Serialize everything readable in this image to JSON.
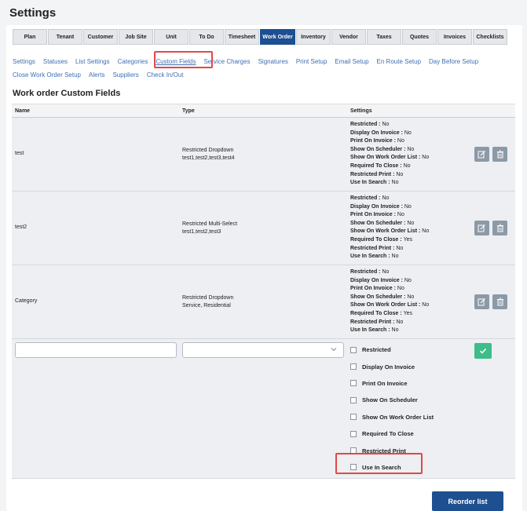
{
  "header": {
    "title": "Settings"
  },
  "main_tabs": [
    {
      "label": "Plan"
    },
    {
      "label": "Tenant"
    },
    {
      "label": "Customer"
    },
    {
      "label": "Job Site"
    },
    {
      "label": "Unit"
    },
    {
      "label": "To Do"
    },
    {
      "label": "Timesheet"
    },
    {
      "label": "Work Order"
    },
    {
      "label": "Inventory"
    },
    {
      "label": "Vendor"
    },
    {
      "label": "Taxes"
    },
    {
      "label": "Quotes"
    },
    {
      "label": "Invoices"
    },
    {
      "label": "Checklists"
    }
  ],
  "main_tabs_active": "Work Order",
  "subnav": {
    "row1": [
      {
        "label": "Settings"
      },
      {
        "label": "Statuses"
      },
      {
        "label": "List Settings"
      },
      {
        "label": "Categories"
      },
      {
        "label": "Custom Fields"
      },
      {
        "label": "Service Charges"
      },
      {
        "label": "Signatures"
      },
      {
        "label": "Print Setup"
      },
      {
        "label": "Email Setup"
      },
      {
        "label": "En Route Setup"
      },
      {
        "label": "Day Before Setup"
      }
    ],
    "row2": [
      {
        "label": "Close Work Order Setup"
      },
      {
        "label": "Alerts"
      },
      {
        "label": "Suppliers"
      },
      {
        "label": "Check In/Out"
      }
    ],
    "active": "Custom Fields"
  },
  "section": {
    "title": "Work order Custom Fields"
  },
  "table": {
    "headers": {
      "name": "Name",
      "type": "Type",
      "settings": "Settings"
    },
    "rows": [
      {
        "name": "test",
        "type_label": "Restricted Dropdown",
        "type_values": "test1,test2,test3,test4",
        "settings": [
          {
            "k": "Restricted",
            "v": "No"
          },
          {
            "k": "Display On Invoice",
            "v": "No"
          },
          {
            "k": "Print On Invoice",
            "v": "No"
          },
          {
            "k": "Show On Scheduler",
            "v": "No"
          },
          {
            "k": "Show On Work Order List",
            "v": "No"
          },
          {
            "k": "Required To Close",
            "v": "No"
          },
          {
            "k": "Restricted Print",
            "v": "No"
          },
          {
            "k": "Use In Search",
            "v": "No"
          }
        ]
      },
      {
        "name": "test2",
        "type_label": "Restricted Multi-Select",
        "type_values": "test1,test2,test3",
        "settings": [
          {
            "k": "Restricted",
            "v": "No"
          },
          {
            "k": "Display On Invoice",
            "v": "No"
          },
          {
            "k": "Print On Invoice",
            "v": "No"
          },
          {
            "k": "Show On Scheduler",
            "v": "No"
          },
          {
            "k": "Show On Work Order List",
            "v": "No"
          },
          {
            "k": "Required To Close",
            "v": "Yes"
          },
          {
            "k": "Restricted Print",
            "v": "No"
          },
          {
            "k": "Use In Search",
            "v": "No"
          }
        ]
      },
      {
        "name": "Category",
        "type_label": "Restricted Dropdown",
        "type_values": "Service, Residential",
        "settings": [
          {
            "k": "Restricted",
            "v": "No"
          },
          {
            "k": "Display On Invoice",
            "v": "No"
          },
          {
            "k": "Print On Invoice",
            "v": "No"
          },
          {
            "k": "Show On Scheduler",
            "v": "No"
          },
          {
            "k": "Show On Work Order List",
            "v": "No"
          },
          {
            "k": "Required To Close",
            "v": "Yes"
          },
          {
            "k": "Restricted Print",
            "v": "No"
          },
          {
            "k": "Use In Search",
            "v": "No"
          }
        ]
      }
    ]
  },
  "new_row": {
    "name_value": "",
    "type_value": "",
    "options": [
      {
        "label": "Restricted",
        "checked": false
      },
      {
        "label": "Display On Invoice",
        "checked": false
      },
      {
        "label": "Print On Invoice",
        "checked": false
      },
      {
        "label": "Show On Scheduler",
        "checked": false
      },
      {
        "label": "Show On Work Order List",
        "checked": false
      },
      {
        "label": "Required To Close",
        "checked": false
      },
      {
        "label": "Restricted Print",
        "checked": false
      },
      {
        "label": "Use In Search",
        "checked": false
      }
    ]
  },
  "footer": {
    "reorder_label": "Reorder list"
  },
  "colors": {
    "primary": "#1d4f91",
    "link": "#3f6fb3",
    "success": "#3ebd8a",
    "action_gray": "#8c9aa7",
    "highlight": "#e04848"
  }
}
